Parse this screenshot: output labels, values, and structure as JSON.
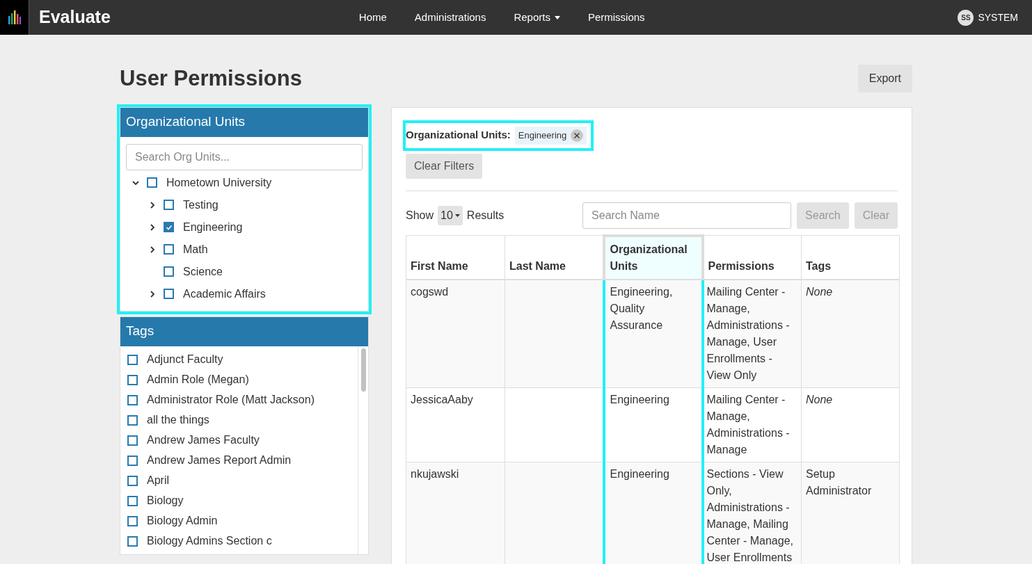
{
  "navbar": {
    "brand": "Evaluate",
    "links": [
      {
        "label": "Home",
        "dropdown": false
      },
      {
        "label": "Administrations",
        "dropdown": false
      },
      {
        "label": "Reports",
        "dropdown": true
      },
      {
        "label": "Permissions",
        "dropdown": false
      }
    ],
    "user": {
      "initials": "SS",
      "name": "SYSTEM"
    }
  },
  "page": {
    "title": "User Permissions",
    "export_button": "Export"
  },
  "org_units": {
    "title": "Organizational Units",
    "search_placeholder": "Search Org Units...",
    "highlighted": true,
    "tree": [
      {
        "label": "Hometown University",
        "kind": "branch",
        "expanded": true,
        "checked": false,
        "children": [
          {
            "label": "Testing",
            "kind": "branch",
            "expanded": false,
            "checked": false
          },
          {
            "label": "Engineering",
            "kind": "branch",
            "expanded": false,
            "checked": true
          },
          {
            "label": "Math",
            "kind": "branch",
            "expanded": false,
            "checked": false
          },
          {
            "label": "Science",
            "kind": "leaf",
            "checked": false
          },
          {
            "label": "Academic Affairs",
            "kind": "branch",
            "expanded": false,
            "checked": false
          }
        ]
      }
    ]
  },
  "tags": {
    "title": "Tags",
    "items": [
      {
        "label": "Adjunct Faculty",
        "checked": false
      },
      {
        "label": "Admin Role (Megan)",
        "checked": false
      },
      {
        "label": "Administrator Role (Matt Jackson)",
        "checked": false
      },
      {
        "label": "all the things",
        "checked": false
      },
      {
        "label": "Andrew James Faculty",
        "checked": false
      },
      {
        "label": "Andrew James Report Admin",
        "checked": false
      },
      {
        "label": "April",
        "checked": false
      },
      {
        "label": "Biology",
        "checked": false
      },
      {
        "label": "Biology Admin",
        "checked": false
      },
      {
        "label": "Biology Admins Section c",
        "checked": false
      }
    ]
  },
  "filters": {
    "label": "Organizational Units:",
    "chips": [
      "Engineering"
    ],
    "highlighted": true,
    "clear_button": "Clear Filters"
  },
  "results": {
    "show_label": "Show",
    "page_size": "10",
    "results_label": "Results",
    "search_placeholder": "Search Name",
    "search_button": "Search",
    "clear_button": "Clear"
  },
  "table": {
    "columns": [
      {
        "label": "First Name",
        "highlighted": false
      },
      {
        "label": "Last Name",
        "highlighted": false
      },
      {
        "label": "Organizational Units",
        "highlighted": true
      },
      {
        "label": "Permissions",
        "highlighted": false
      },
      {
        "label": "Tags",
        "highlighted": false
      }
    ],
    "rows": [
      {
        "first_name": "cogswd",
        "last_name": "",
        "org_units": "Engineering, Quality Assurance",
        "permissions": "Mailing Center - Manage, Administrations - Manage, User Enrollments - View Only",
        "tags": "None",
        "tags_empty": true
      },
      {
        "first_name": "JessicaAaby",
        "last_name": "",
        "org_units": "Engineering",
        "permissions": "Mailing Center - Manage, Administrations - Manage",
        "tags": "None",
        "tags_empty": true
      },
      {
        "first_name": "nkujawski",
        "last_name": "",
        "org_units": "Engineering",
        "permissions": "Sections - View Only, Administrations - Manage, Mailing Center - Manage, User Enrollments",
        "tags": "Setup Administrator",
        "tags_empty": false
      }
    ]
  }
}
